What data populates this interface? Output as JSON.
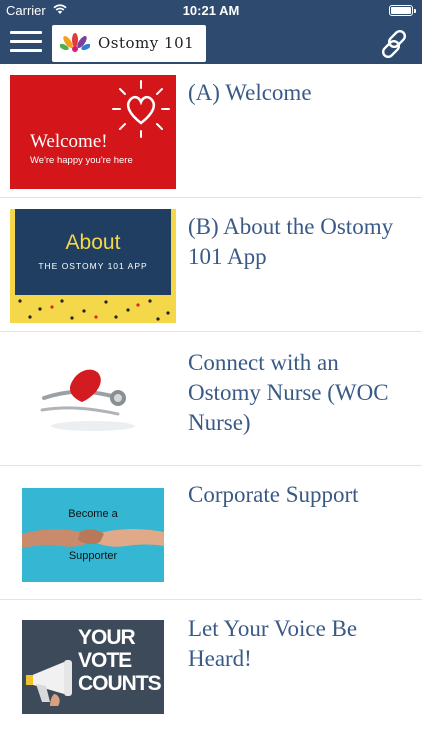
{
  "status_bar": {
    "carrier": "Carrier",
    "time": "10:21 AM"
  },
  "nav": {
    "app_title": "Ostomy 101",
    "bar_color": "#2e4a6e"
  },
  "items": [
    {
      "title": "(A) Welcome",
      "thumb": {
        "heading": "Welcome!",
        "sub": "We're happy you're here"
      }
    },
    {
      "title": "(B) About the Ostomy 101 App",
      "thumb": {
        "heading": "About",
        "sub": "THE OSTOMY 101 APP"
      }
    },
    {
      "title": "Connect with an Ostomy Nurse (WOC Nurse)",
      "thumb": {}
    },
    {
      "title": "Corporate Support",
      "thumb": {
        "line1": "Become a",
        "line2": "Supporter"
      }
    },
    {
      "title": "Let Your Voice Be Heard!",
      "thumb": {
        "line1": "YOUR",
        "line2": "VOTE",
        "line3": "COUNTS"
      }
    }
  ],
  "colors": {
    "title_text": "#3a5a86",
    "divider": "#e3e3e3"
  }
}
